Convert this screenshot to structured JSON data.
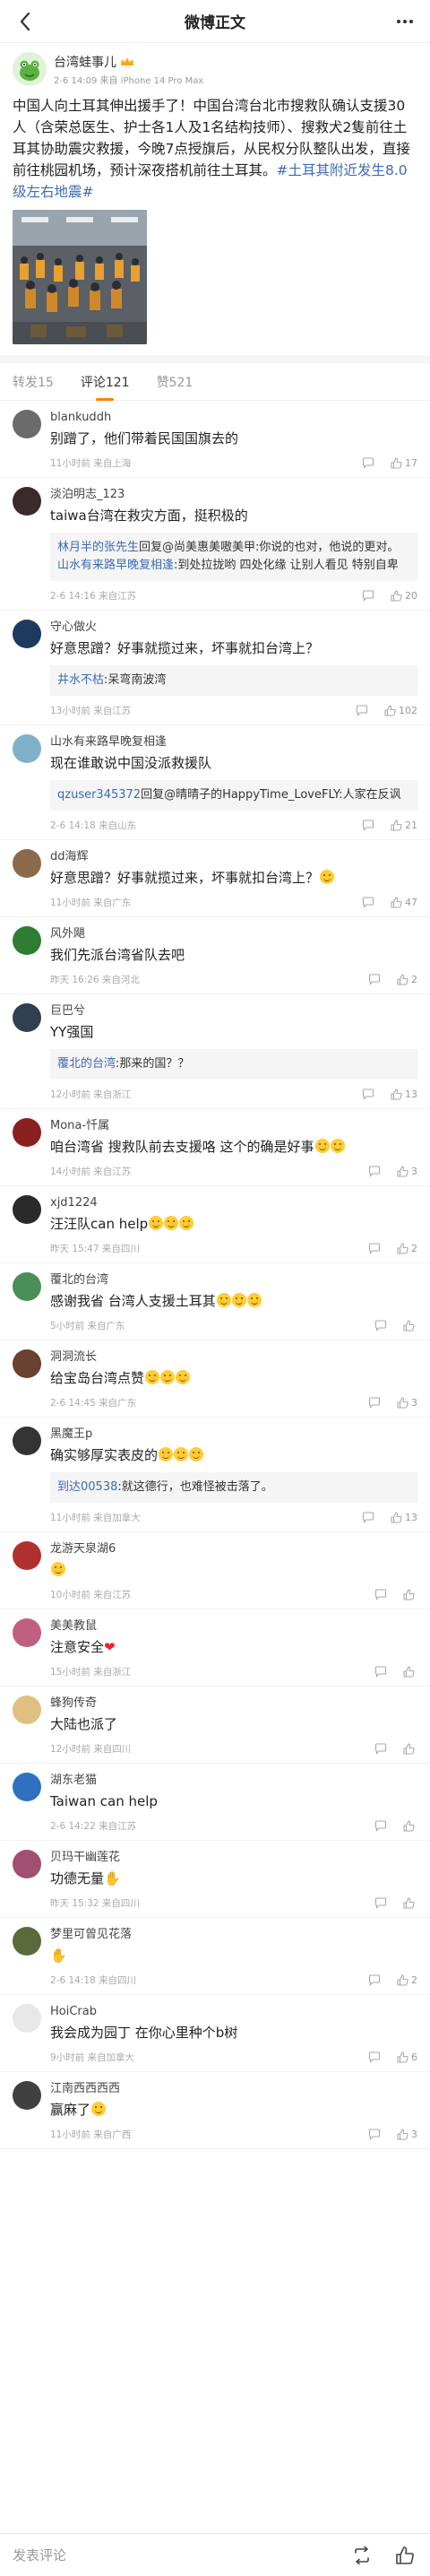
{
  "nav": {
    "title": "微博正文"
  },
  "post": {
    "author": "台湾蛙事儿",
    "subline": "2-6 14:09 来自 iPhone 14 Pro Max",
    "text": "中国人向土耳其伸出援手了！中国台湾台北市搜救队确认支援30人（含荣总医生、护士各1人及1名结构技师）、搜救犬2隻前往土耳其协助震灾救援，今晚7点授旗后，从民权分队整队出发，直接前往桃园机场，预计深夜搭机前往土耳其。",
    "hashtag": "#土耳其附近发生8.0级左右地震#"
  },
  "tabs": [
    {
      "label": "转发15"
    },
    {
      "label": "评论121"
    },
    {
      "label": "赞521"
    }
  ],
  "comments": [
    {
      "name": "blankuddh",
      "text": "别蹭了，他们带着民国国旗去的",
      "time": "11小时前 来自上海",
      "likes": "17",
      "avatar_color": "#6b6b6b"
    },
    {
      "name": "淡泊明志_123",
      "text": "taiwa台湾在救灾方面，挺积极的",
      "time": "2-6 14:16 来自江苏",
      "likes": "20",
      "avatar_color": "#3a2a2a",
      "replies": [
        {
          "user": "林月半的张先生",
          "text": "回复@尚美惠美嗷美甲:你说的也对，他说的更对。"
        },
        {
          "user": "山水有来路早晚复相逢",
          "text": ":到处拉拢哟 四处化缘 让别人看见 特别自卑"
        }
      ]
    },
    {
      "name": "守心做火",
      "text": "好意思蹭？好事就揽过来，坏事就扣台湾上？",
      "time": "13小时前 来自江苏",
      "likes": "102",
      "avatar_color": "#1f3a5f",
      "replies": [
        {
          "user": "井水不枯",
          "text": ":呆弯南波湾"
        }
      ]
    },
    {
      "name": "山水有来路早晚复相逢",
      "text": "现在谁敢说中国没派救援队",
      "time": "2-6 14:18 来自山东",
      "likes": "21",
      "avatar_color": "#7fb0c8",
      "replies": [
        {
          "user": "qzuser345372",
          "text": "回复@晴晴子的HappyTime_LoveFLY:人家在反讽"
        }
      ]
    },
    {
      "name": "dd海辉",
      "text": "好意思蹭？好事就揽过来，坏事就扣台湾上？",
      "time": "11小时前 来自广东",
      "likes": "47",
      "avatar_color": "#8a6a4a"
    },
    {
      "name": "风外飓",
      "text": "我们先派台湾省队去吧",
      "time": "昨天 16:26 来自河北",
      "likes": "2",
      "avatar_color": "#2e7d32"
    },
    {
      "name": "巨巴兮",
      "text": "YY强国",
      "time": "12小时前 来自浙江",
      "likes": "13",
      "avatar_color": "#304050",
      "replies": [
        {
          "user": "覆北的台湾",
          "text": ":那来的国？？"
        }
      ]
    },
    {
      "name": "Mona-忏属",
      "text": "咱台湾省 搜救队前去支援咯 这个的确是好事",
      "time": "14小时前 来自江苏",
      "likes": "3",
      "avatar_color": "#8a2020"
    },
    {
      "name": "xjd1224",
      "text": "汪汪队can help",
      "time": "昨天 15:47 来自四川",
      "likes": "2",
      "avatar_color": "#2a2a2a"
    },
    {
      "name": "覆北的台湾",
      "text": "感谢我省 台湾人支援土耳其",
      "time": "5小时前 来自广东",
      "likes": "",
      "avatar_color": "#4a8f5a"
    },
    {
      "name": "洞洞流长",
      "text": "给宝岛台湾点赞",
      "time": "2-6 14:45 来自广东",
      "likes": "3",
      "avatar_color": "#6a4030"
    },
    {
      "name": "黑魔王p",
      "text": "确实够厚实表皮的",
      "time": "11小时前 来自加拿大",
      "likes": "13",
      "avatar_color": "#333333",
      "replies": [
        {
          "user": "到达00538",
          "text": ":就这德行，也难怪被击落了。"
        }
      ]
    },
    {
      "name": "龙游天泉湖6",
      "text": "",
      "time": "10小时前 来自江苏",
      "likes": "",
      "avatar_color": "#b03030"
    },
    {
      "name": "美美教鼠",
      "text": "注意安全",
      "time": "15小时前 来自浙江",
      "likes": "",
      "avatar_color": "#c06080"
    },
    {
      "name": "蜂狗传奇",
      "text": "大陆也派了",
      "time": "12小时前 来自四川",
      "likes": "",
      "avatar_color": "#e0c080"
    },
    {
      "name": "湖东老猫",
      "text": "Taiwan can help",
      "time": "2-6 14:22 来自江苏",
      "likes": "",
      "avatar_color": "#3070c0"
    },
    {
      "name": "贝玛干幽莲花",
      "text": "功德无量",
      "time": "昨天 15:32 来自四川",
      "likes": "",
      "avatar_color": "#a05070"
    },
    {
      "name": "梦里可曾见花落",
      "text": "",
      "time": "2-6 14:18 来自四川",
      "likes": "2",
      "avatar_color": "#5a6a3a"
    },
    {
      "name": "HoiCrab",
      "text": "我会成为园丁 在你心里种个b树",
      "time": "9小时前 来自加拿大",
      "likes": "6",
      "avatar_color": "#e8e8e8"
    },
    {
      "name": "江南西西西西",
      "text": "赢麻了",
      "time": "11小时前 来自广西",
      "likes": "3",
      "avatar_color": "#404040"
    }
  ],
  "bottom": {
    "placeholder": "发表评论"
  }
}
